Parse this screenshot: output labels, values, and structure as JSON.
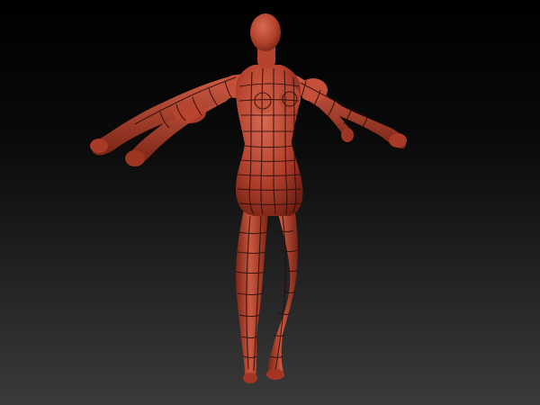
{
  "scene": {
    "subject": "sculpted-humanoid-figure",
    "pose": "a-pose",
    "colors": {
      "background_top": "#000000",
      "background_bottom": "#3a3a3a",
      "clay_light": "#d86a52",
      "clay_base": "#b5432f",
      "clay_dark": "#6e1e12",
      "wire": "#2a0c08"
    }
  }
}
